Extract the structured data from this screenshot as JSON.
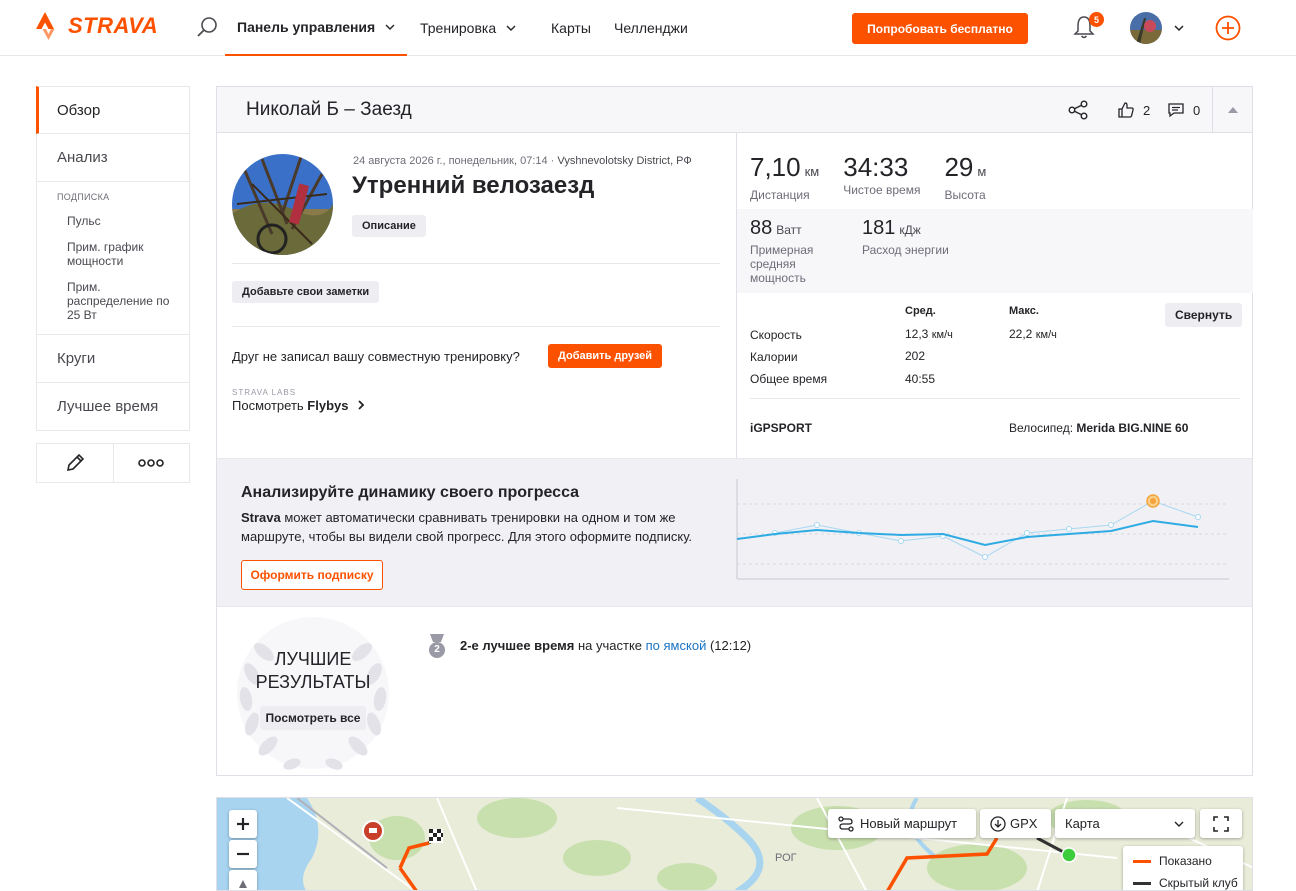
{
  "nav": {
    "brand": "STRAVA",
    "items": [
      {
        "label": "Панель управления",
        "has_dropdown": true,
        "active": true
      },
      {
        "label": "Тренировка",
        "has_dropdown": true,
        "active": false
      },
      {
        "label": "Карты",
        "has_dropdown": false,
        "active": false
      },
      {
        "label": "Челленджи",
        "has_dropdown": false,
        "active": false
      }
    ],
    "try_free_label": "Попробовать бесплатно",
    "notification_count": "5",
    "accent_color": "#fc5200"
  },
  "sidebar": {
    "items": [
      "Обзор",
      "Анализ"
    ],
    "subscription_heading": "ПОДПИСКА",
    "subscription_items": [
      "Пульс",
      "Прим. график мощности",
      "Прим. распределение по 25 Вт"
    ],
    "items_after": [
      "Круги",
      "Лучшее время"
    ],
    "icons": [
      "pencil-icon",
      "more-icon"
    ]
  },
  "activity": {
    "header_title": "Николай Б – Заезд",
    "likes": "2",
    "comments": "0",
    "date_location_prefix": "24 августа 2026 г., понедельник, 07:14 · ",
    "location": "Vyshnevolotsky District, РФ",
    "name": "Утренний велозаезд",
    "description_label": "Описание",
    "add_notes_label": "Добавьте свои заметки",
    "friend_prompt": "Друг не записал вашу совместную тренировку?",
    "add_friends_label": "Добавить друзей",
    "labs_label": "STRAVA LABS",
    "flybys_prefix": "Посмотреть ",
    "flybys_bold": "Flybys"
  },
  "stats": {
    "primary": [
      {
        "value": "7,10",
        "unit": "км",
        "label": "Дистанция"
      },
      {
        "value": "34:33",
        "unit": "",
        "label": "Чистое время"
      },
      {
        "value": "29",
        "unit": "м",
        "label": "Высота"
      }
    ],
    "secondary": [
      {
        "value": "88",
        "unit": "Ватт",
        "label": "Примерная средняя мощность"
      },
      {
        "value": "181",
        "unit": "кДж",
        "label": "Расход энергии"
      }
    ],
    "table": {
      "col_avg": "Сред.",
      "col_max": "Макс.",
      "rows": [
        {
          "label": "Скорость",
          "avg": "12,3",
          "avg_unit": "км/ч",
          "max": "22,2",
          "max_unit": "км/ч"
        },
        {
          "label": "Калории",
          "avg": "202",
          "avg_unit": "",
          "max": "",
          "max_unit": ""
        },
        {
          "label": "Общее время",
          "avg": "40:55",
          "avg_unit": "",
          "max": "",
          "max_unit": ""
        }
      ]
    },
    "collapse_label": "Свернуть",
    "device": "iGPSPORT",
    "bike_label": "Велосипед: ",
    "bike_name": "Merida BIG.NINE 60"
  },
  "promo": {
    "title": "Анализируйте динамику своего прогресса",
    "text_bold": "Strava",
    "text_rest": " может автоматически сравнивать тренировки на одном и том же маршруте, чтобы вы видели свой прогресс. Для этого оформите подписку.",
    "subscribe_label": "Оформить подписку",
    "line_color": "#2eabe3"
  },
  "best_efforts": {
    "title_line1": "ЛУЧШИЕ",
    "title_line2": "РЕЗУЛЬТАТЫ",
    "view_all_label": "Посмотреть все",
    "medal_rank": "2",
    "effort_bold": "2-е лучшее время",
    "effort_mid": " на участке ",
    "segment_name": "по ямской",
    "effort_time": " (12:12)"
  },
  "map": {
    "new_route_label": "Новый маршрут",
    "gpx_label": "GPX",
    "map_type_label": "Карта",
    "legend": [
      {
        "label": "Показано",
        "color": "#fc5200"
      },
      {
        "label": "Скрытый клуб",
        "color": "#333333"
      }
    ]
  }
}
